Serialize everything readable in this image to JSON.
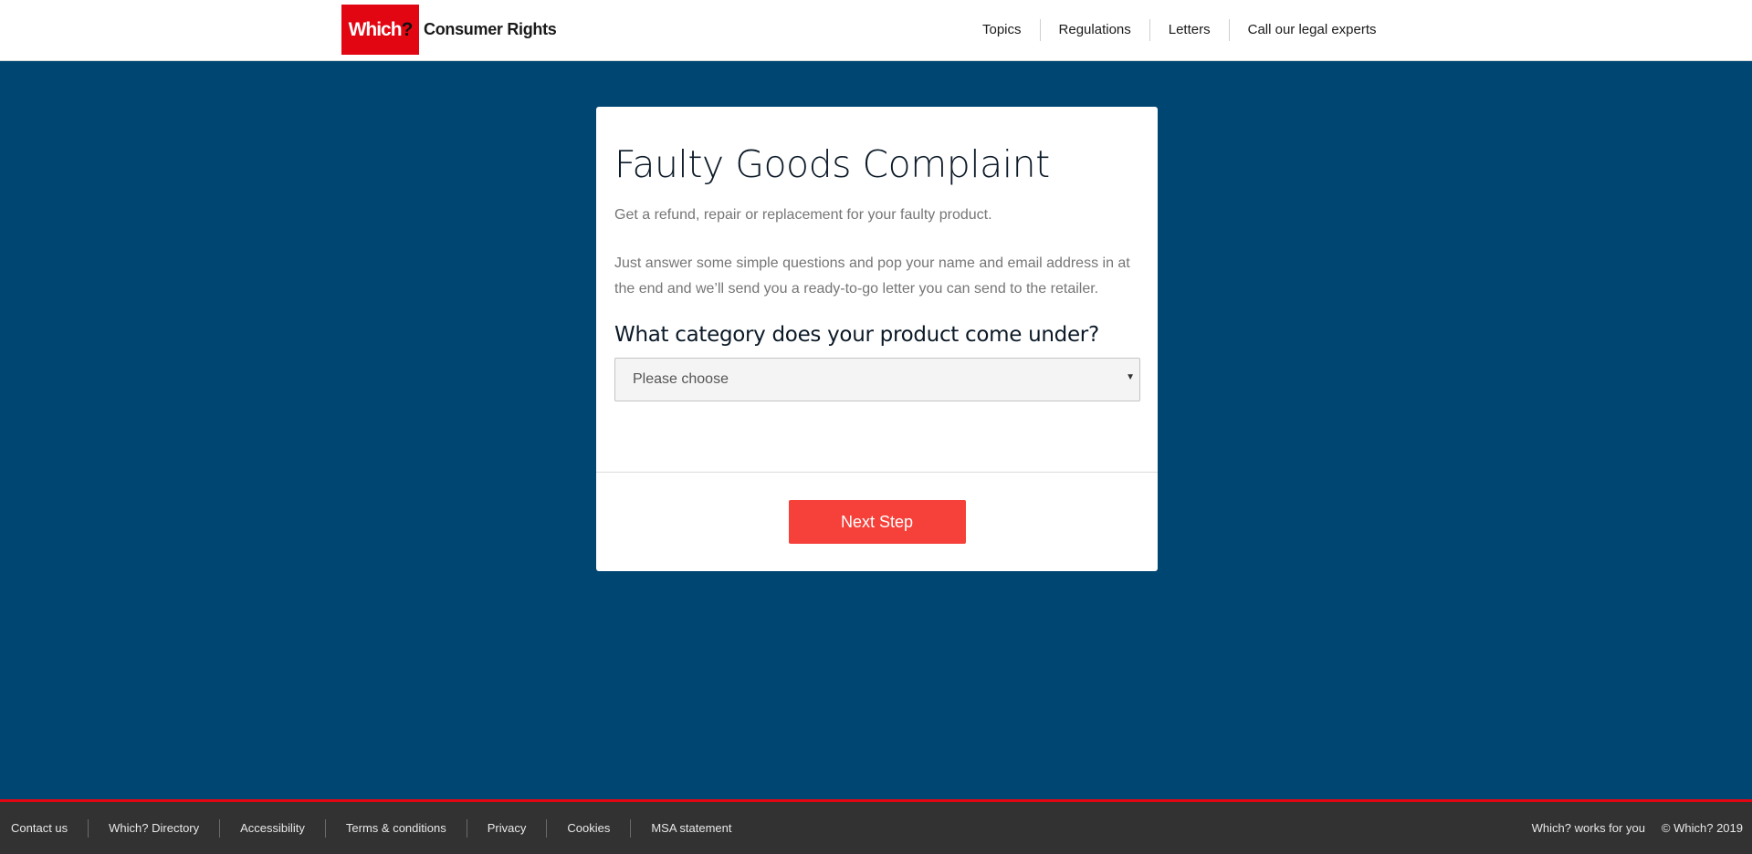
{
  "header": {
    "logo_mark": "Which",
    "logo_mark_q": "?",
    "logo_text": "Consumer Rights",
    "nav": [
      "Topics",
      "Regulations",
      "Letters",
      "Call our legal experts"
    ]
  },
  "form": {
    "title": "Faulty Goods Complaint",
    "lead": "Get a refund, repair or replacement for your faulty product.",
    "description": "Just answer some simple questions and pop your name and email address in at the end and we’ll send you a ready-to-go letter you can send to the retailer.",
    "question": "What category does your product come under?",
    "select_value": "Please choose",
    "next_label": "Next Step"
  },
  "footer": {
    "links": [
      "Contact us",
      "Which? Directory",
      "Accessibility",
      "Terms & conditions",
      "Privacy",
      "Cookies",
      "MSA statement"
    ],
    "works_for_you": "Which? works for you",
    "copyright": "© Which? 2019"
  },
  "colors": {
    "background": "#004672",
    "brand_red": "#e20613",
    "button": "#f6413a",
    "footer": "#323232"
  },
  "icons": {
    "select_caret": "caret-down-icon"
  }
}
